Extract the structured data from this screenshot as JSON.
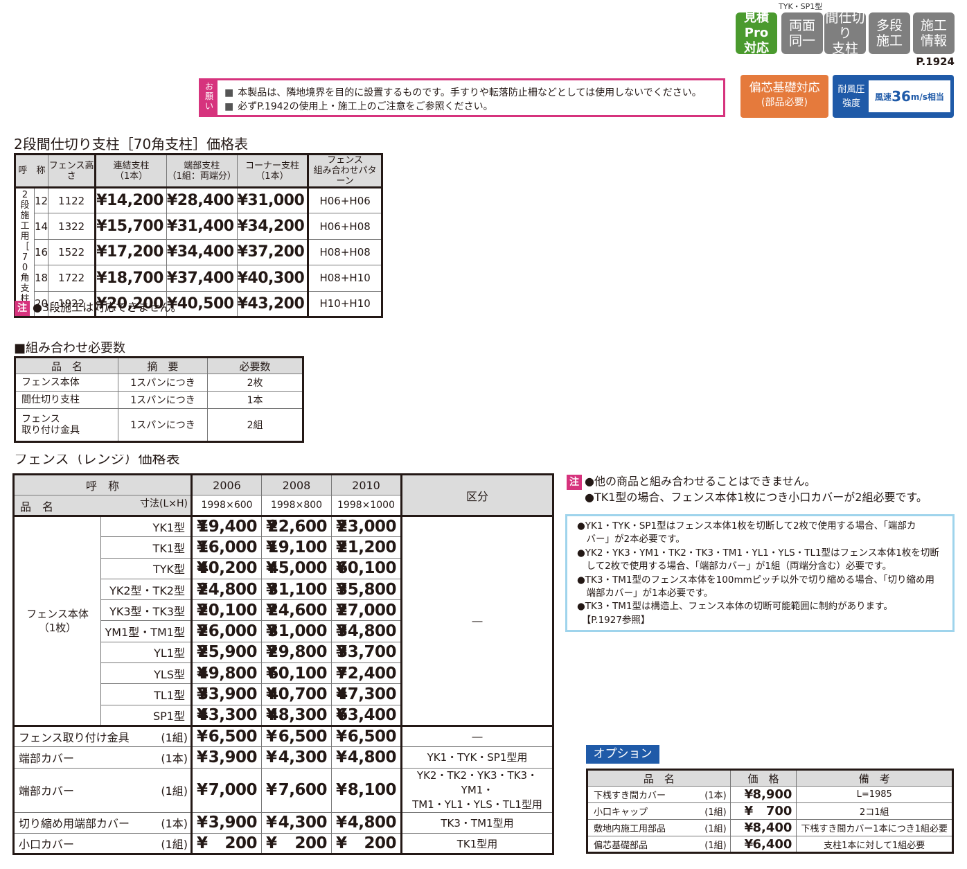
{
  "header": {
    "model_label": "TYK・SP1型",
    "badges": [
      {
        "line1": "見積Pro",
        "line2": "対応",
        "color": "#4a9a2e"
      },
      {
        "line1": "両面",
        "line2": "同一",
        "color": "#7f7f7f"
      },
      {
        "line1": "間仕切り",
        "line2": "支柱",
        "color": "#7f7f7f"
      },
      {
        "line1": "多段",
        "line2": "施工",
        "color": "#7f7f7f"
      },
      {
        "line1": "施工",
        "line2": "情報",
        "color": "#7f7f7f"
      }
    ],
    "page_ref": "P.1924"
  },
  "request": {
    "tag": "お願い",
    "lines": [
      "本製品は、隣地境界を目的に設置するものです。手すりや転落防止柵などとしては使用しないでください。",
      "必ずP.1942の使用上・施工上のご注意をご参照ください。"
    ]
  },
  "offset_badge": {
    "line1": "偏芯基礎対応",
    "line2": "(部品必要)"
  },
  "wind_badge": {
    "left_line1": "耐風圧",
    "left_line2": "強度",
    "prefix": "風速",
    "value": "36",
    "unit": "m/s相当"
  },
  "post_section": {
    "title": "2段間仕切り支柱［70角支柱］価格表",
    "headers": [
      "呼　称",
      "フェンス高さ",
      "連結支柱\n（1本）",
      "端部支柱\n（1組：両端分）",
      "コーナー支柱\n（1本）",
      "フェンス\n組み合わせパターン"
    ],
    "side_label": "2段施工用［70角支柱］",
    "rows": [
      {
        "code": "12",
        "height": "1122",
        "joint": "¥14,200",
        "end": "¥28,400",
        "corner": "¥31,000",
        "pattern": "H06+H06"
      },
      {
        "code": "14",
        "height": "1322",
        "joint": "¥15,700",
        "end": "¥31,400",
        "corner": "¥34,200",
        "pattern": "H06+H08"
      },
      {
        "code": "16",
        "height": "1522",
        "joint": "¥17,200",
        "end": "¥34,400",
        "corner": "¥37,200",
        "pattern": "H08+H08"
      },
      {
        "code": "18",
        "height": "1722",
        "joint": "¥18,700",
        "end": "¥37,400",
        "corner": "¥40,300",
        "pattern": "H08+H10"
      },
      {
        "code": "20",
        "height": "1922",
        "joint": "¥20,200",
        "end": "¥40,500",
        "corner": "¥43,200",
        "pattern": "H10+H10"
      }
    ],
    "note_mark": "注",
    "note": "●3段施工は対応できません。"
  },
  "combo_section": {
    "title": "■組み合わせ必要数",
    "headers": [
      "品　名",
      "摘　要",
      "必要数"
    ],
    "rows": [
      {
        "name": "フェンス本体",
        "desc": "1スパンにつき",
        "qty": "2枚"
      },
      {
        "name": "間仕切り支柱",
        "desc": "1スパンにつき",
        "qty": "1本"
      },
      {
        "name": "フェンス\n取り付け金具",
        "desc": "1スパンにつき",
        "qty": "2組"
      }
    ]
  },
  "fence_section": {
    "title": "フェンス（レンジ）価格表",
    "header_label": "呼　称",
    "size_label": "寸法(L×H)",
    "name_label": "品　名",
    "category_label": "区分",
    "columns": [
      {
        "code": "2006",
        "size": "1998×600"
      },
      {
        "code": "2008",
        "size": "1998×800"
      },
      {
        "code": "2010",
        "size": "1998×1000"
      }
    ],
    "body_label_1": "フェンス本体",
    "body_label_2": "（1枚）",
    "body_category": "―",
    "yen": "¥",
    "body_rows": [
      {
        "model": "YK1型",
        "p1": "19,400",
        "p2": "22,600",
        "p3": "23,000"
      },
      {
        "model": "TK1型",
        "p1": "16,000",
        "p2": "19,100",
        "p3": "21,200"
      },
      {
        "model": "TYK型",
        "p1": "40,200",
        "p2": "45,000",
        "p3": "60,100"
      },
      {
        "model": "YK2型・TK2型",
        "p1": "24,800",
        "p2": "31,100",
        "p3": "35,800"
      },
      {
        "model": "YK3型・TK3型",
        "p1": "20,100",
        "p2": "24,600",
        "p3": "27,000"
      },
      {
        "model": "YM1型・TM1型",
        "p1": "26,000",
        "p2": "31,000",
        "p3": "34,800"
      },
      {
        "model": "YL1型",
        "p1": "25,900",
        "p2": "29,800",
        "p3": "33,700"
      },
      {
        "model": "YLS型",
        "p1": "49,800",
        "p2": "60,100",
        "p3": "72,400"
      },
      {
        "model": "TL1型",
        "p1": "33,900",
        "p2": "40,700",
        "p3": "47,300"
      },
      {
        "model": "SP1型",
        "p1": "43,300",
        "p2": "48,300",
        "p3": "63,400"
      }
    ],
    "accessory_rows": [
      {
        "name": "フェンス取り付け金具",
        "unit": "(1組)",
        "p1": "6,500",
        "p2": "6,500",
        "p3": "6,500",
        "category": "―"
      },
      {
        "name": "端部カバー",
        "unit": "(1本)",
        "p1": "3,900",
        "p2": "4,300",
        "p3": "4,800",
        "category": "YK1・TYK・SP1型用"
      },
      {
        "name": "端部カバー",
        "unit": "(1組)",
        "p1": "7,000",
        "p2": "7,600",
        "p3": "8,100",
        "category": "YK2・TK2・YK3・TK3・YM1・\nTM1・YL1・YLS・TL1型用"
      },
      {
        "name": "切り縮め用端部カバー",
        "unit": "(1本)",
        "p1": "3,900",
        "p2": "4,300",
        "p3": "4,800",
        "category": "TK3・TM1型用"
      },
      {
        "name": "小口カバー",
        "unit": "(1組)",
        "p1": "200",
        "p2": "200",
        "p3": "200",
        "category": "TK1型用"
      }
    ]
  },
  "right_notes": {
    "mark": "注",
    "lines": [
      "●他の商品と組み合わせることはできません。",
      "●TK1型の場合、フェンス本体1枚につき小口カバーが2組必要です。"
    ]
  },
  "info_box": {
    "lines": [
      "●YK1・TYK・SP1型はフェンス本体1枚を切断して2枚で使用する場合、「端部カ",
      "　バー」が2本必要です。",
      "●YK2・YK3・YM1・TK2・TK3・TM1・YL1・YLS・TL1型はフェンス本体1枚を切断",
      "　して2枚で使用する場合、「端部カバー」が1組（両端分含む）必要です。",
      "●TK3・TM1型のフェンス本体を100mmピッチ以外で切り縮める場合、「切り縮め用",
      "　端部カバー」が1本必要です。",
      "●TK3・TM1型は構造上、フェンス本体の切断可能範囲に制約があります。",
      "　【P.1927参照】"
    ]
  },
  "option_section": {
    "title": "オプション",
    "headers": [
      "品　名",
      "価　格",
      "備　考"
    ],
    "rows": [
      {
        "name": "下桟すき間カバー",
        "unit": "(1本)",
        "price": "8,900",
        "note": "L=1985"
      },
      {
        "name": "小口キャップ",
        "unit": "(1組)",
        "price": "700",
        "note": "2コ1組"
      },
      {
        "name": "敷地内施工用部品",
        "unit": "(1組)",
        "price": "8,400",
        "note": "下桟すき間カバー1本につき1組必要"
      },
      {
        "name": "偏芯基礎部品",
        "unit": "(1組)",
        "price": "6,400",
        "note": "支柱1本に対して1組必要"
      }
    ]
  }
}
